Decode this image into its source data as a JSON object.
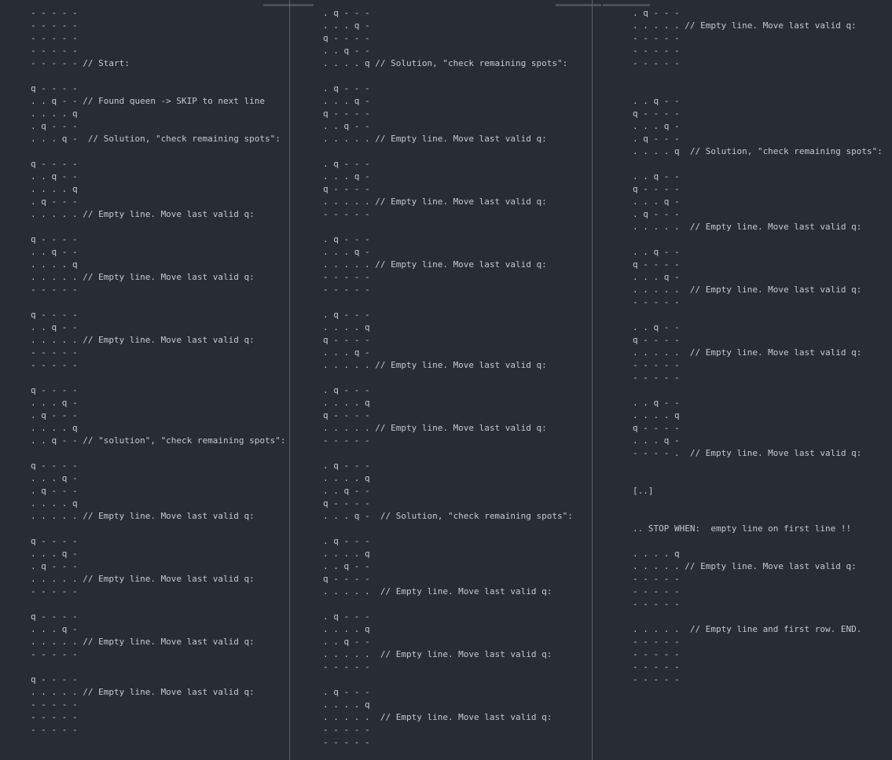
{
  "editor": {
    "colors": {
      "background": "#282c34",
      "text": "#c3c9d2",
      "divider": "#5b616b",
      "tab_marker": "#4a505a"
    },
    "panes": [
      {
        "name": "left",
        "lines": [
          "- - - - -",
          "- - - - -",
          "- - - - -",
          "- - - - -",
          "- - - - - // Start:",
          "",
          "q - - - -",
          ". . q - - // Found queen -> SKIP to next line",
          ". . . . q",
          ". q - - -",
          ". . . q -  // Solution, \"check remaining spots\":",
          "",
          "q - - - -",
          ". . q - -",
          ". . . . q",
          ". q - - -",
          ". . . . . // Empty line. Move last valid q:",
          "",
          "q - - - -",
          ". . q - -",
          ". . . . q",
          ". . . . . // Empty line. Move last valid q:",
          "- - - - -",
          "",
          "q - - - -",
          ". . q - -",
          ". . . . . // Empty line. Move last valid q:",
          "- - - - -",
          "- - - - -",
          "",
          "q - - - -",
          ". . . q -",
          ". q - - -",
          ". . . . q",
          ". . q - - // \"solution\", \"check remaining spots\":",
          "",
          "q - - - -",
          ". . . q -",
          ". q - - -",
          ". . . . q",
          ". . . . . // Empty line. Move last valid q:",
          "",
          "q - - - -",
          ". . . q -",
          ". q - - -",
          ". . . . . // Empty line. Move last valid q:",
          "- - - - -",
          "",
          "q - - - -",
          ". . . q -",
          ". . . . . // Empty line. Move last valid q:",
          "- - - - -",
          "",
          "q - - - -",
          ". . . . . // Empty line. Move last valid q:",
          "- - - - -",
          "- - - - -",
          "- - - - -"
        ]
      },
      {
        "name": "middle",
        "lines": [
          ". q - - -",
          ". . . q -",
          "q - - - -",
          ". . q - -",
          ". . . . q // Solution, \"check remaining spots\":",
          "",
          ". q - - -",
          ". . . q -",
          "q - - - -",
          ". . q - -",
          ". . . . . // Empty line. Move last valid q:",
          "",
          ". q - - -",
          ". . . q -",
          "q - - - -",
          ". . . . . // Empty line. Move last valid q:",
          "- - - - -",
          "",
          ". q - - -",
          ". . . q -",
          ". . . . . // Empty line. Move last valid q:",
          "- - - - -",
          "- - - - -",
          "",
          ". q - - -",
          ". . . . q",
          "q - - - -",
          ". . . q -",
          ". . . . . // Empty line. Move last valid q:",
          "",
          ". q - - -",
          ". . . . q",
          "q - - - -",
          ". . . . . // Empty line. Move last valid q:",
          "- - - - -",
          "",
          ". q - - -",
          ". . . . q",
          ". . q - -",
          "q - - - -",
          ". . . q -  // Solution, \"check remaining spots\":",
          "",
          ". q - - -",
          ". . . . q",
          ". . q - -",
          "q - - - -",
          ". . . . .  // Empty line. Move last valid q:",
          "",
          ". q - - -",
          ". . . . q",
          ". . q - -",
          ". . . . .  // Empty line. Move last valid q:",
          "- - - - -",
          "",
          ". q - - -",
          ". . . . q",
          ". . . . .  // Empty line. Move last valid q:",
          "- - - - -",
          "- - - - -"
        ]
      },
      {
        "name": "right",
        "lines": [
          ". q - - -",
          ". . . . . // Empty line. Move last valid q:",
          "- - - - -",
          "- - - - -",
          "- - - - -",
          "",
          "",
          ". . q - -",
          "q - - - -",
          ". . . q -",
          ". q - - -",
          ". . . . q  // Solution, \"check remaining spots\":",
          "",
          ". . q - -",
          "q - - - -",
          ". . . q -",
          ". q - - -",
          ". . . . .  // Empty line. Move last valid q:",
          "",
          ". . q - -",
          "q - - - -",
          ". . . q -",
          ". . . . .  // Empty line. Move last valid q:",
          "- - - - -",
          "",
          ". . q - -",
          "q - - - -",
          ". . . . .  // Empty line. Move last valid q:",
          "- - - - -",
          "- - - - -",
          "",
          ". . q - -",
          ". . . . q",
          "q - - - -",
          ". . . q -",
          "- - - - .  // Empty line. Move last valid q:",
          "",
          "",
          "[..]",
          "",
          "",
          ".. STOP WHEN:  empty line on first line !!",
          "",
          ". . . . q",
          ". . . . . // Empty line. Move last valid q:",
          "- - - - -",
          "- - - - -",
          "- - - - -",
          "",
          ". . . . .  // Empty line and first row. END.",
          "- - - - -",
          "- - - - -",
          "- - - - -",
          "- - - - -"
        ]
      }
    ]
  }
}
